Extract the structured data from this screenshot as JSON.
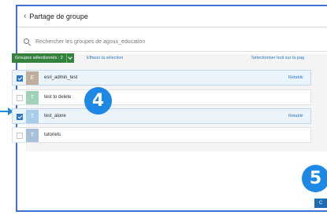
{
  "header": {
    "title": "Partage de groupe"
  },
  "search": {
    "placeholder": "Rechercher les groupes de agoux_education"
  },
  "toolbar": {
    "selection_label": "Groupes sélectionnés : 2",
    "clear_label": "Effacer la sélection",
    "select_all_label": "Sélectionner tout sur la pag"
  },
  "groups": [
    {
      "initial": "E",
      "name": "esri_admin_test",
      "checked": true,
      "action": "Rétablir",
      "thumb_color": "#c0ad9c"
    },
    {
      "initial": "T",
      "name": "test to delete",
      "checked": false,
      "action": "",
      "thumb_color": "#9fd3b6"
    },
    {
      "initial": "T",
      "name": "test_alone",
      "checked": true,
      "action": "Rétablir",
      "thumb_color": "#a8cdea"
    },
    {
      "initial": "T",
      "name": "tutoriels",
      "checked": false,
      "action": "",
      "thumb_color": "#a7c1dc"
    }
  ],
  "annotations": {
    "step_a": "4",
    "step_b": "5"
  },
  "footer": {
    "button_label": "C"
  },
  "colors": {
    "primary_green": "#35823f",
    "link_blue": "#2a7ac0",
    "badge_blue": "#1e88e5",
    "frame_blue": "#3d6fd6"
  }
}
